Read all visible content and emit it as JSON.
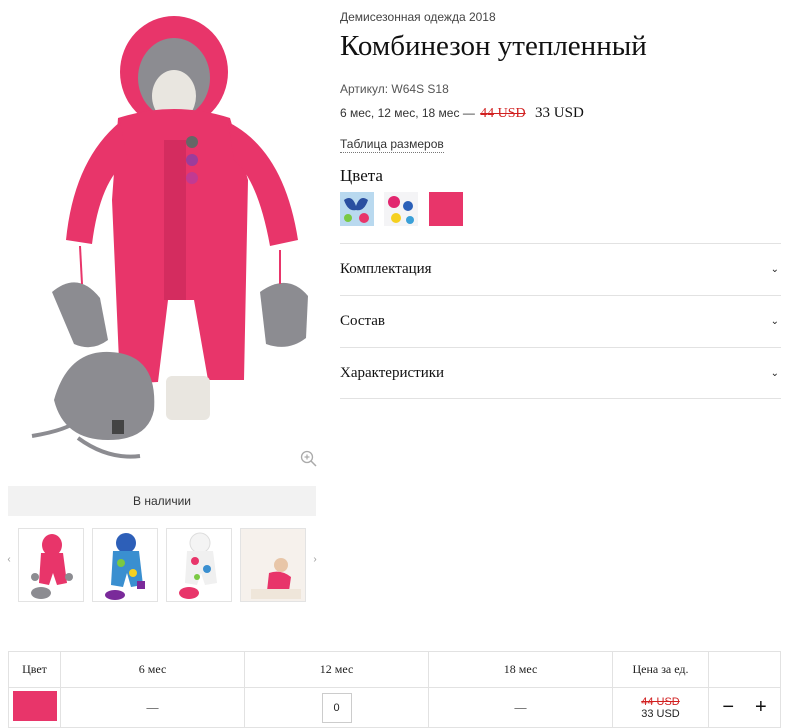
{
  "product": {
    "collection": "Демисезонная одежда 2018",
    "title": "Комбинезон утепленный",
    "article": "Артикул: W64S S18",
    "sizes_text": "6 мес, 12 мес, 18 мес —",
    "price_old": "44 USD",
    "price_new": "33 USD",
    "size_table_link": "Таблица размеров",
    "colors_label": "Цвета",
    "stock_status": "В наличии"
  },
  "gallery": {
    "prev_arrow": "‹",
    "next_arrow": "›",
    "thumbnails": [
      "pink-suit",
      "blue-print-suit",
      "white-print-suit",
      "child-photo"
    ]
  },
  "colors": [
    {
      "name": "blue-butterfly",
      "accent": "#2a4fa0"
    },
    {
      "name": "white-floral",
      "accent": "#e2266f"
    },
    {
      "name": "pink",
      "accent": "#e8356a"
    }
  ],
  "accordion": [
    {
      "label": "Комплектация",
      "icon": "chevron-down-icon"
    },
    {
      "label": "Состав",
      "icon": "chevron-down-icon"
    },
    {
      "label": "Характеристики",
      "icon": "chevron-down-icon"
    }
  ],
  "accordion_chevron": "⌄",
  "order_table": {
    "headers": [
      "Цвет",
      "6 мес",
      "12 мес",
      "18 мес",
      "Цена за ед.",
      ""
    ],
    "row": {
      "swatch_color": "#e8356a",
      "col_6": "—",
      "col_12_qty": "0",
      "col_18": "—",
      "price_old": "44 USD",
      "price_new": "33 USD",
      "minus": "−",
      "plus": "+"
    }
  },
  "colors_theme": {
    "accent_pink": "#e8356a",
    "price_red": "#d11f1f",
    "hat_gray": "#8c8c91"
  }
}
